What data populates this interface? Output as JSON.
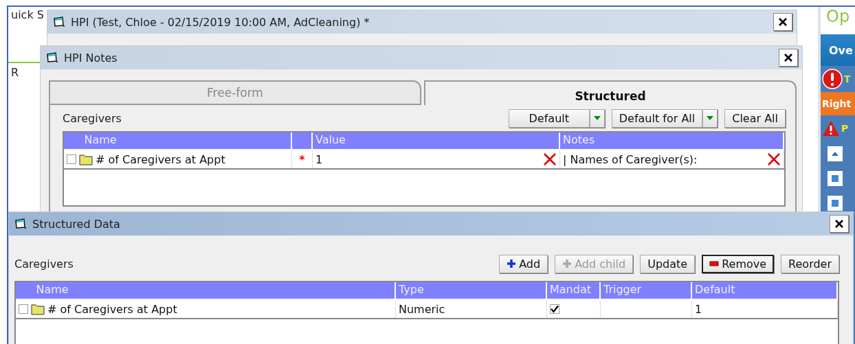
{
  "background": {
    "texts": [
      "uick S",
      "R"
    ]
  },
  "sidebar": {
    "header": "Op",
    "tab": "Ove",
    "items": [
      {
        "kind": "error",
        "text": "T"
      },
      {
        "kind": "banner",
        "text": "Right"
      },
      {
        "kind": "warning",
        "text": "P"
      },
      {
        "kind": "up"
      },
      {
        "kind": "square"
      },
      {
        "kind": "square"
      }
    ]
  },
  "hpi_window": {
    "title": "HPI (Test, Chloe - 02/15/2019  10:00 AM, AdCleaning) *"
  },
  "notes_window": {
    "title": "HPI Notes",
    "tabs": [
      {
        "label": "Free-form",
        "selected": false
      },
      {
        "label": "Structured",
        "selected": true
      }
    ],
    "section": "Caregivers",
    "buttons": [
      {
        "label": "Default",
        "kind": "split"
      },
      {
        "label": "Default for All",
        "kind": "split"
      },
      {
        "label": "Clear All",
        "kind": "plain"
      }
    ],
    "columns": [
      "Name",
      "Value",
      "Notes"
    ],
    "rows": [
      {
        "name": "# of Caregivers at Appt",
        "checked": false,
        "mark": "*",
        "value": "1",
        "notes": "| Names of Caregiver(s):"
      }
    ]
  },
  "data_window": {
    "title": "Structured Data",
    "section": "Caregivers",
    "buttons": [
      {
        "label": "Add",
        "kind": "add",
        "disabled": false,
        "focused": false
      },
      {
        "label": "Add child",
        "kind": "add",
        "disabled": true,
        "focused": false
      },
      {
        "label": "Update",
        "kind": "plain",
        "disabled": false,
        "focused": false
      },
      {
        "label": "Remove",
        "kind": "remove",
        "disabled": false,
        "focused": true
      },
      {
        "label": "Reorder",
        "kind": "plain",
        "disabled": false,
        "focused": false
      }
    ],
    "columns": [
      "Name",
      "Type",
      "Mandat",
      "Trigger",
      "Default"
    ],
    "rows": [
      {
        "name": "# of Caregivers at Appt",
        "checked": false,
        "type": "Numeric",
        "mandatory": true,
        "default": "1"
      }
    ]
  }
}
